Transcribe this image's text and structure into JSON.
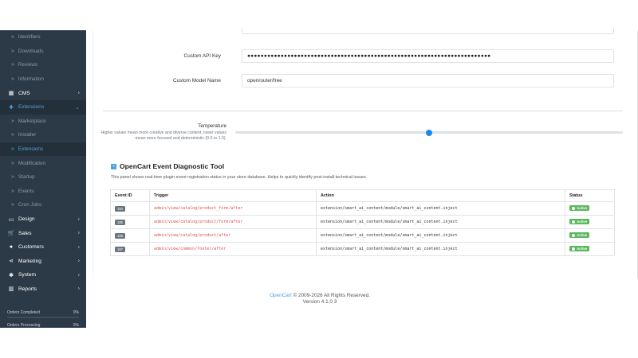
{
  "sidebar": {
    "items": [
      {
        "label": "Identifiers",
        "type": "sub"
      },
      {
        "label": "Downloads",
        "type": "sub"
      },
      {
        "label": "Reviews",
        "type": "sub"
      },
      {
        "label": "Information",
        "type": "sub"
      },
      {
        "label": "CMS",
        "type": "top",
        "icon": "cms-icon"
      },
      {
        "label": "Extensions",
        "type": "open",
        "icon": "puzzle-icon"
      },
      {
        "label": "Marketplace",
        "type": "sub"
      },
      {
        "label": "Installer",
        "type": "sub"
      },
      {
        "label": "Extensions",
        "type": "sub-active"
      },
      {
        "label": "Modification",
        "type": "sub"
      },
      {
        "label": "Startup",
        "type": "sub"
      },
      {
        "label": "Events",
        "type": "sub"
      },
      {
        "label": "Cron Jobs",
        "type": "sub"
      },
      {
        "label": "Design",
        "type": "top",
        "icon": "monitor-icon"
      },
      {
        "label": "Sales",
        "type": "top",
        "icon": "cart-icon"
      },
      {
        "label": "Customers",
        "type": "top",
        "icon": "user-icon"
      },
      {
        "label": "Marketing",
        "type": "top",
        "icon": "share-icon"
      },
      {
        "label": "System",
        "type": "top",
        "icon": "gear-icon"
      },
      {
        "label": "Reports",
        "type": "top",
        "icon": "chart-icon"
      }
    ],
    "stats": [
      {
        "label": "Orders Completed",
        "value": "0%",
        "fill": 0
      },
      {
        "label": "Orders Processing",
        "value": "0%",
        "fill": 0
      }
    ]
  },
  "form": {
    "api_key_label": "Custom API Key",
    "api_key_value": "●●●●●●●●●●●●●●●●●●●●●●●●●●●●●●●●●●●●●●●●●●●●●●●●●●●●●●●●●●●●●●●●●●●●●●●●●",
    "model_label": "Custom Model Name",
    "model_value": "openrouter/free",
    "temperature_label": "Temperature",
    "temperature_help": "Higher values mean more creative and diverse content, lower values mean more focused and deterministic (0.0 to 1.0).",
    "temperature_value": 0.5
  },
  "diagnostic": {
    "title": "OpenCart Event Diagnostic Tool",
    "description": "This panel shows real-time plugin event registration status in your store database. Helps to quickly identify post-install technical issues.",
    "columns": [
      "Event ID",
      "Trigger",
      "Action",
      "Status"
    ],
    "rows": [
      {
        "id": "184",
        "trigger": "admin/view/catalog/product_form/after",
        "action": "extension/smart_ai_content/module/smart_ai_content.inject",
        "status": "Active"
      },
      {
        "id": "185",
        "trigger": "admin/view/catalog/product/form/after",
        "action": "extension/smart_ai_content/module/smart_ai_content.inject",
        "status": "Active"
      },
      {
        "id": "186",
        "trigger": "admin/view/catalog/product/after",
        "action": "extension/smart_ai_content/module/smart_ai_content.inject",
        "status": "Active"
      },
      {
        "id": "187",
        "trigger": "admin/view/common/footer/after",
        "action": "extension/smart_ai_content/module/smart_ai_content.inject",
        "status": "Active"
      }
    ]
  },
  "footer": {
    "brand": "OpenCart",
    "copyright": "© 2009-2026 All Rights Reserved.",
    "version": "Version 4.1.0.3"
  },
  "colors": {
    "sidebar_bg": "#2c3a47",
    "accent": "#4fa3e0",
    "trigger_red": "#d9534f",
    "active_green": "#5cb85c"
  }
}
